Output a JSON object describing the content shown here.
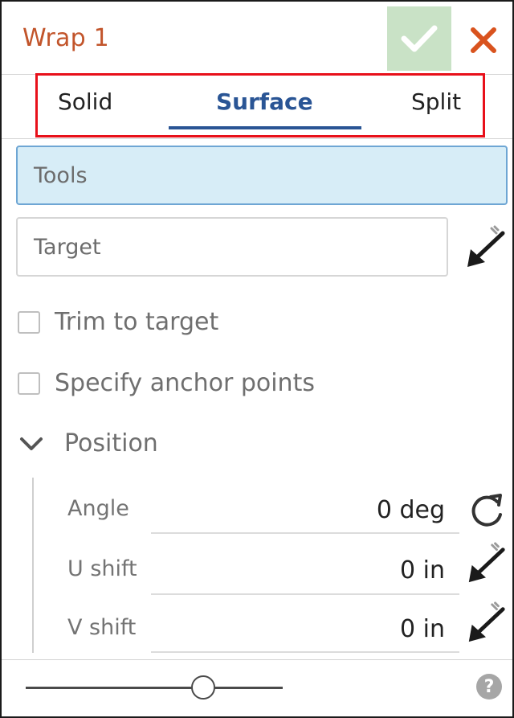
{
  "dialog": {
    "title": "Wrap 1",
    "accent_color": "#c2552b",
    "ok_icon": "check-icon",
    "close_icon": "close-icon"
  },
  "tabs": [
    {
      "label": "Solid",
      "active": false
    },
    {
      "label": "Surface",
      "active": true
    },
    {
      "label": "Split",
      "active": false
    }
  ],
  "fields": {
    "tools_label": "Tools",
    "target_label": "Target"
  },
  "options": {
    "trim_to_target": {
      "label": "Trim to target",
      "checked": false
    },
    "specify_anchor_points": {
      "label": "Specify anchor points",
      "checked": false
    }
  },
  "position": {
    "section_label": "Position",
    "expanded": true,
    "angle": {
      "label": "Angle",
      "value": "0 deg",
      "icon": "rotate-icon"
    },
    "u_shift": {
      "label": "U shift",
      "value": "0 in",
      "icon": "selection-arrow-icon"
    },
    "v_shift": {
      "label": "V shift",
      "value": "0 in",
      "icon": "selection-arrow-icon"
    }
  },
  "footer": {
    "help_label": "?",
    "slider_level": 0.68
  }
}
